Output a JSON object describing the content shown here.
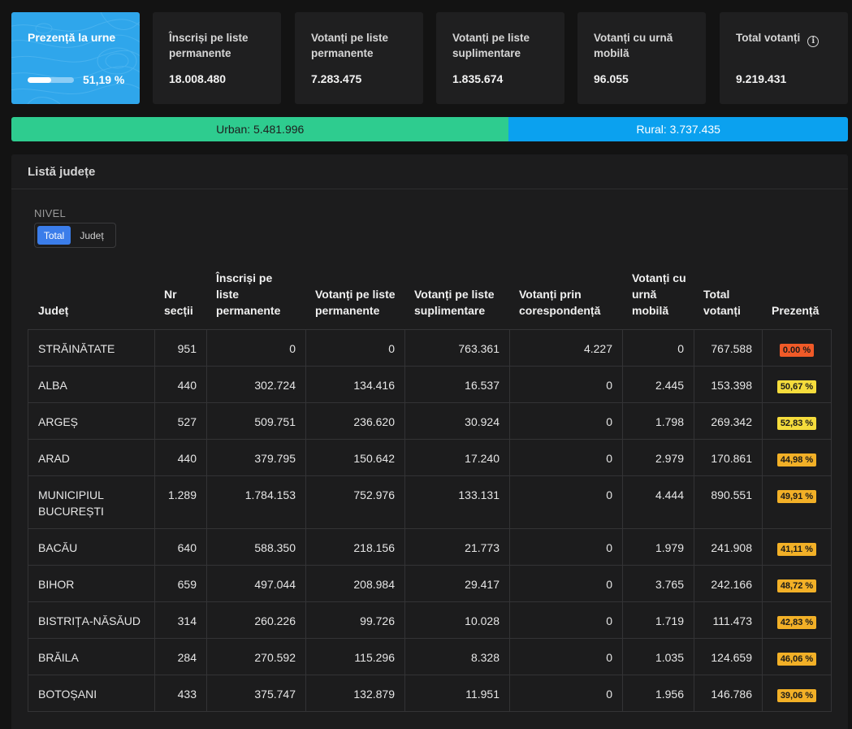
{
  "summary": {
    "presence": {
      "label": "Prezență la urne",
      "value": "51,19 %",
      "fraction": 0.5119
    },
    "cards": [
      {
        "label": "Înscriși pe liste permanente",
        "value": "18.008.480"
      },
      {
        "label": "Votanți pe liste permanente",
        "value": "7.283.475"
      },
      {
        "label": "Votanți pe liste suplimentare",
        "value": "1.835.674"
      },
      {
        "label": "Votanți cu urnă mobilă",
        "value": "96.055"
      },
      {
        "label": "Total votanți",
        "value": "9.219.431"
      }
    ],
    "info_icon": "info-icon"
  },
  "urban_rural": {
    "urban": "Urban: 5.481.996",
    "rural": "Rural: 3.737.435",
    "urban_count": 5481996,
    "rural_count": 3737435,
    "urban_color": "#2ecc8f",
    "rural_color": "#0ba1ef"
  },
  "panel": {
    "title": "Listă județe",
    "nivel_label": "NIVEL",
    "nivel_options": [
      "Total",
      "Județ"
    ],
    "nivel_selected": "Total"
  },
  "table": {
    "headers": [
      "Județ",
      "Nr secții",
      "Înscriși pe liste permanente",
      "Votanți pe liste permanente",
      "Votanți pe liste suplimentare",
      "Votanți prin corespondență",
      "Votanți cu urnă mobilă",
      "Total votanți",
      "Prezență"
    ],
    "rows": [
      {
        "cells": [
          "STRĂINĂTATE",
          "951",
          "0",
          "0",
          "763.361",
          "4.227",
          "0",
          "767.588"
        ],
        "presence": "0.00 %",
        "color": "#f05a28"
      },
      {
        "cells": [
          "ALBA",
          "440",
          "302.724",
          "134.416",
          "16.537",
          "0",
          "2.445",
          "153.398"
        ],
        "presence": "50,67 %",
        "color": "#f5dc3c"
      },
      {
        "cells": [
          "ARGEȘ",
          "527",
          "509.751",
          "236.620",
          "30.924",
          "0",
          "1.798",
          "269.342"
        ],
        "presence": "52,83 %",
        "color": "#f5dc3c"
      },
      {
        "cells": [
          "ARAD",
          "440",
          "379.795",
          "150.642",
          "17.240",
          "0",
          "2.979",
          "170.861"
        ],
        "presence": "44,98 %",
        "color": "#f2b027"
      },
      {
        "cells": [
          "MUNICIPIUL BUCUREȘTI",
          "1.289",
          "1.784.153",
          "752.976",
          "133.131",
          "0",
          "4.444",
          "890.551"
        ],
        "presence": "49,91 %",
        "color": "#f2b027"
      },
      {
        "cells": [
          "BACĂU",
          "640",
          "588.350",
          "218.156",
          "21.773",
          "0",
          "1.979",
          "241.908"
        ],
        "presence": "41,11 %",
        "color": "#f2b027"
      },
      {
        "cells": [
          "BIHOR",
          "659",
          "497.044",
          "208.984",
          "29.417",
          "0",
          "3.765",
          "242.166"
        ],
        "presence": "48,72 %",
        "color": "#f2b027"
      },
      {
        "cells": [
          "BISTRIȚA-NĂSĂUD",
          "314",
          "260.226",
          "99.726",
          "10.028",
          "0",
          "1.719",
          "111.473"
        ],
        "presence": "42,83 %",
        "color": "#f2b027"
      },
      {
        "cells": [
          "BRĂILA",
          "284",
          "270.592",
          "115.296",
          "8.328",
          "0",
          "1.035",
          "124.659"
        ],
        "presence": "46,06 %",
        "color": "#f2b027"
      },
      {
        "cells": [
          "BOTOȘANI",
          "433",
          "375.747",
          "132.879",
          "11.951",
          "0",
          "1.956",
          "146.786"
        ],
        "presence": "39,06 %",
        "color": "#f2b027"
      }
    ]
  }
}
